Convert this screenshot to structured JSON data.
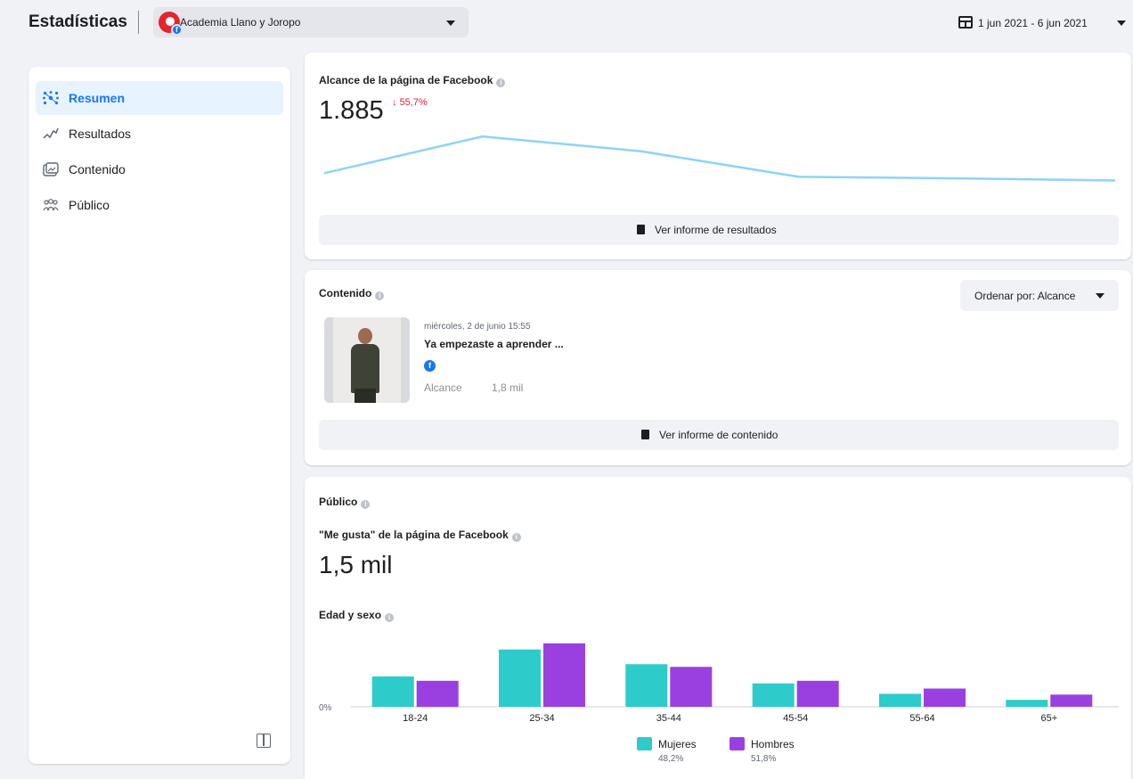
{
  "header": {
    "title": "Estadísticas",
    "page_name": "Academia Llano y Joropo",
    "date_range": "1 jun 2021 - 6 jun 2021"
  },
  "sidebar": {
    "items": [
      {
        "label": "Resumen",
        "icon": "summary-icon",
        "active": true
      },
      {
        "label": "Resultados",
        "icon": "results-chart-icon",
        "active": false
      },
      {
        "label": "Contenido",
        "icon": "content-icon",
        "active": false
      },
      {
        "label": "Público",
        "icon": "audience-icon",
        "active": false
      }
    ]
  },
  "reach_card": {
    "title": "Alcance de la página de Facebook",
    "value": "1.885",
    "change": "55,7%",
    "change_direction": "down",
    "button": "Ver informe de resultados",
    "chart_data": {
      "type": "line",
      "x": [
        1,
        2,
        3,
        4,
        5,
        6
      ],
      "values": [
        1,
        1.5,
        1.3,
        0.95,
        0.93,
        0.9
      ],
      "color": "#8ed3f7"
    }
  },
  "content_card": {
    "title": "Contenido",
    "sort_label": "Ordenar por: Alcance",
    "post": {
      "date": "miércoles, 2 de junio 15:55",
      "title": "Ya empezaste a aprender ...",
      "metric_label": "Alcance",
      "metric_value": "1,8 mil"
    },
    "button": "Ver informe de contenido"
  },
  "audience_card": {
    "title": "Público",
    "likes_label": "\"Me gusta\" de la página de Facebook",
    "likes_value": "1,5 mil",
    "age_gender_label": "Edad y sexo",
    "chart_data": {
      "type": "bar",
      "categories": [
        "18-24",
        "25-34",
        "35-44",
        "45-54",
        "55-64",
        "65+"
      ],
      "series": [
        {
          "name": "Mujeres",
          "percent": "48,2%",
          "color": "#2ecbcb",
          "values": [
            35,
            66,
            49,
            27,
            15,
            8
          ]
        },
        {
          "name": "Hombres",
          "percent": "51,8%",
          "color": "#9b40e0",
          "values": [
            30,
            73,
            46,
            30,
            21,
            14
          ]
        }
      ],
      "y_tick_label": "0%",
      "ylim": [
        0,
        80
      ]
    }
  },
  "colors": {
    "accent": "#1877f2",
    "negative": "#e41e3f"
  }
}
